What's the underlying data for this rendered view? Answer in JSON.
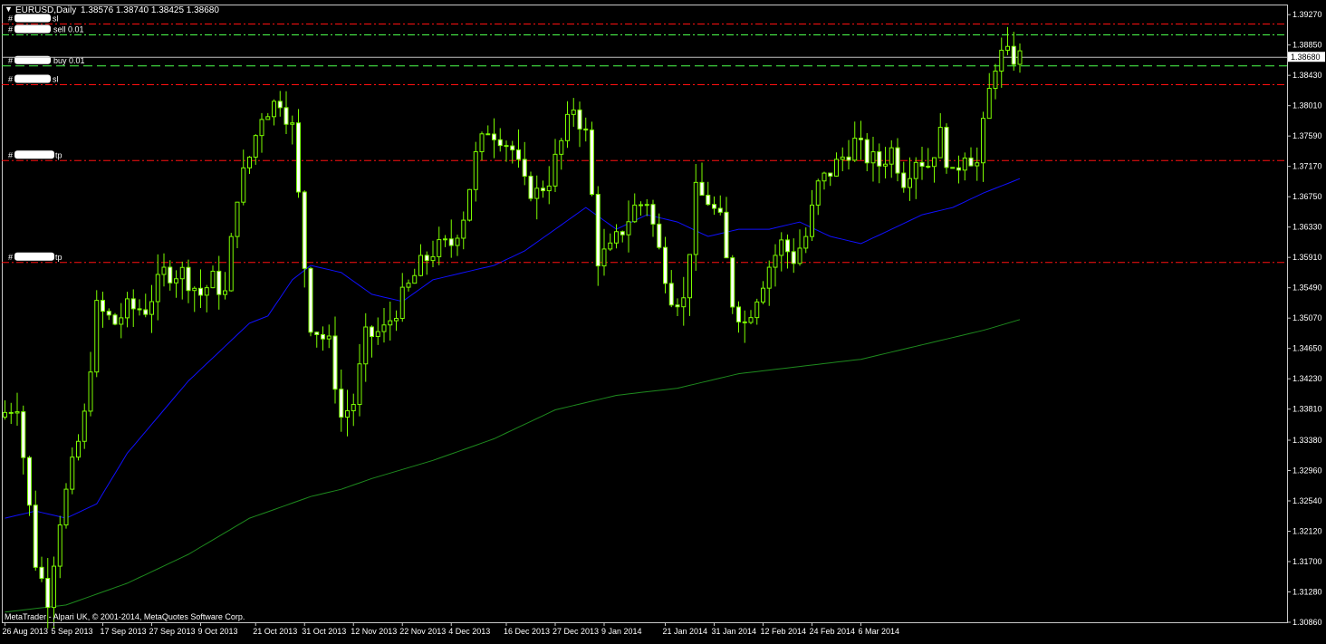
{
  "header": {
    "title": "EURUSD,Daily",
    "ohlc": "1.38576 1.38740 1.38425 1.38680"
  },
  "footer": {
    "copyright": "MetaTrader - Alpari UK, © 2001-2014, MetaQuotes Software Corp."
  },
  "colors": {
    "background": "#000000",
    "frame": "#c8c8c8",
    "bull_body": "#000000",
    "bear_body": "#ffffff",
    "wick": "#7cfc00",
    "ma_fast": "#1010ff",
    "ma_slow": "#1e8a1e",
    "sl_line": "#ff1010",
    "tp_line": "#ff1010",
    "sell_line": "#4cff4c",
    "buy_line": "#4cff4c",
    "price_line": "#c0c0c0",
    "text": "#ffffff"
  },
  "chart_data": {
    "type": "candlestick",
    "ylim": [
      1.3086,
      1.3941
    ],
    "current_price": "1.38680",
    "current_price_value": 1.3868,
    "y_ticks": [
      "1.39270",
      "1.38850",
      "1.38430",
      "1.38010",
      "1.37590",
      "1.37170",
      "1.36750",
      "1.36330",
      "1.35910",
      "1.35490",
      "1.35070",
      "1.34650",
      "1.34230",
      "1.33810",
      "1.33380",
      "1.32960",
      "1.32540",
      "1.32120",
      "1.31700",
      "1.31280",
      "1.30860"
    ],
    "x_ticks": [
      {
        "index": 0,
        "label": "26 Aug 2013"
      },
      {
        "index": 8,
        "label": "5 Sep 2013"
      },
      {
        "index": 16,
        "label": "17 Sep 2013"
      },
      {
        "index": 24,
        "label": "27 Sep 2013"
      },
      {
        "index": 32,
        "label": "9 Oct 2013"
      },
      {
        "index": 41,
        "label": "21 Oct 2013"
      },
      {
        "index": 49,
        "label": "31 Oct 2013"
      },
      {
        "index": 57,
        "label": "12 Nov 2013"
      },
      {
        "index": 65,
        "label": "22 Nov 2013"
      },
      {
        "index": 73,
        "label": "4 Dec 2013"
      },
      {
        "index": 82,
        "label": "16 Dec 2013"
      },
      {
        "index": 90,
        "label": "27 Dec 2013"
      },
      {
        "index": 98,
        "label": "9 Jan 2014"
      },
      {
        "index": 108,
        "label": "21 Jan 2014"
      },
      {
        "index": 116,
        "label": "31 Jan 2014"
      },
      {
        "index": 124,
        "label": "12 Feb 2014"
      },
      {
        "index": 132,
        "label": "24 Feb 2014"
      },
      {
        "index": 140,
        "label": "6 Mar 2014"
      }
    ],
    "levels": [
      {
        "name": "sl-upper",
        "label": "#",
        "suffix": "sl",
        "price": 1.3914,
        "kind": "sl"
      },
      {
        "name": "sell",
        "label": "#",
        "suffix": "sell 0.01",
        "price": 1.3899,
        "kind": "sell"
      },
      {
        "name": "buy",
        "label": "#",
        "suffix": "buy 0.01",
        "price": 1.3856,
        "kind": "buy"
      },
      {
        "name": "sl-lower",
        "label": "#",
        "suffix": "sl",
        "price": 1.383,
        "kind": "sl"
      },
      {
        "name": "tp-upper",
        "label": "#",
        "suffix": "tp",
        "price": 1.3725,
        "kind": "tp"
      },
      {
        "name": "tp-lower",
        "label": "#",
        "suffix": "tp",
        "price": 1.3584,
        "kind": "tp"
      }
    ],
    "waypoints": [
      [
        0,
        1.337
      ],
      [
        3,
        1.339
      ],
      [
        6,
        1.317
      ],
      [
        8,
        1.312
      ],
      [
        10,
        1.323
      ],
      [
        14,
        1.337
      ],
      [
        16,
        1.352
      ],
      [
        19,
        1.35
      ],
      [
        21,
        1.352
      ],
      [
        24,
        1.352
      ],
      [
        27,
        1.357
      ],
      [
        30,
        1.357
      ],
      [
        33,
        1.354
      ],
      [
        35,
        1.356
      ],
      [
        37,
        1.354
      ],
      [
        39,
        1.368
      ],
      [
        41,
        1.373
      ],
      [
        43,
        1.379
      ],
      [
        46,
        1.381
      ],
      [
        48,
        1.377
      ],
      [
        50,
        1.358
      ],
      [
        51,
        1.35
      ],
      [
        54,
        1.347
      ],
      [
        56,
        1.337
      ],
      [
        58,
        1.339
      ],
      [
        60,
        1.348
      ],
      [
        63,
        1.349
      ],
      [
        65,
        1.352
      ],
      [
        67,
        1.355
      ],
      [
        69,
        1.358
      ],
      [
        71,
        1.36
      ],
      [
        74,
        1.361
      ],
      [
        76,
        1.365
      ],
      [
        78,
        1.373
      ],
      [
        80,
        1.377
      ],
      [
        82,
        1.376
      ],
      [
        84,
        1.374
      ],
      [
        86,
        1.369
      ],
      [
        88,
        1.368
      ],
      [
        90,
        1.37
      ],
      [
        92,
        1.375
      ],
      [
        94,
        1.38
      ],
      [
        96,
        1.376
      ],
      [
        98,
        1.359
      ],
      [
        100,
        1.36
      ],
      [
        102,
        1.363
      ],
      [
        104,
        1.366
      ],
      [
        106,
        1.367
      ],
      [
        108,
        1.36
      ],
      [
        110,
        1.354
      ],
      [
        112,
        1.353
      ],
      [
        114,
        1.368
      ],
      [
        116,
        1.367
      ],
      [
        118,
        1.364
      ],
      [
        120,
        1.353
      ],
      [
        122,
        1.35
      ],
      [
        124,
        1.354
      ],
      [
        126,
        1.358
      ],
      [
        128,
        1.361
      ],
      [
        130,
        1.359
      ],
      [
        132,
        1.362
      ],
      [
        134,
        1.369
      ],
      [
        136,
        1.371
      ],
      [
        138,
        1.373
      ],
      [
        140,
        1.375
      ],
      [
        142,
        1.373
      ],
      [
        144,
        1.372
      ],
      [
        146,
        1.374
      ],
      [
        148,
        1.37
      ],
      [
        150,
        1.373
      ],
      [
        152,
        1.372
      ],
      [
        154,
        1.376
      ],
      [
        156,
        1.37
      ],
      [
        158,
        1.374
      ],
      [
        160,
        1.372
      ],
      [
        162,
        1.382
      ],
      [
        163,
        1.386
      ],
      [
        164,
        1.387
      ],
      [
        166,
        1.3868
      ]
    ],
    "ma_fast_points": [
      [
        0,
        1.323
      ],
      [
        5,
        1.324
      ],
      [
        10,
        1.323
      ],
      [
        15,
        1.325
      ],
      [
        20,
        1.332
      ],
      [
        25,
        1.337
      ],
      [
        30,
        1.342
      ],
      [
        35,
        1.346
      ],
      [
        40,
        1.35
      ],
      [
        43,
        1.351
      ],
      [
        47,
        1.356
      ],
      [
        50,
        1.358
      ],
      [
        55,
        1.357
      ],
      [
        60,
        1.354
      ],
      [
        65,
        1.353
      ],
      [
        70,
        1.356
      ],
      [
        75,
        1.357
      ],
      [
        80,
        1.358
      ],
      [
        85,
        1.36
      ],
      [
        90,
        1.363
      ],
      [
        95,
        1.366
      ],
      [
        100,
        1.363
      ],
      [
        105,
        1.365
      ],
      [
        110,
        1.364
      ],
      [
        115,
        1.362
      ],
      [
        120,
        1.363
      ],
      [
        125,
        1.363
      ],
      [
        130,
        1.364
      ],
      [
        135,
        1.362
      ],
      [
        140,
        1.361
      ],
      [
        145,
        1.363
      ],
      [
        150,
        1.365
      ],
      [
        155,
        1.366
      ],
      [
        160,
        1.368
      ],
      [
        166,
        1.37
      ]
    ],
    "ma_slow_points": [
      [
        0,
        1.31
      ],
      [
        10,
        1.311
      ],
      [
        20,
        1.314
      ],
      [
        30,
        1.318
      ],
      [
        40,
        1.323
      ],
      [
        50,
        1.326
      ],
      [
        55,
        1.327
      ],
      [
        60,
        1.3285
      ],
      [
        70,
        1.331
      ],
      [
        80,
        1.334
      ],
      [
        90,
        1.338
      ],
      [
        100,
        1.34
      ],
      [
        110,
        1.341
      ],
      [
        120,
        1.343
      ],
      [
        130,
        1.344
      ],
      [
        140,
        1.345
      ],
      [
        150,
        1.347
      ],
      [
        160,
        1.349
      ],
      [
        166,
        1.3505
      ]
    ],
    "n_bars": 167
  }
}
